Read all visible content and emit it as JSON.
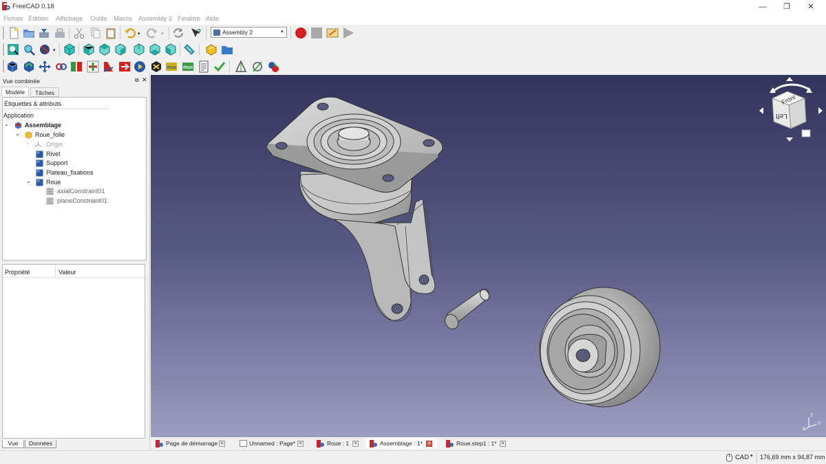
{
  "window": {
    "title": "FreeCAD 0.18",
    "minimize_glyph": "—",
    "restore_glyph": "❐",
    "close_glyph": "✕"
  },
  "menu": {
    "items": [
      "Fichier",
      "Édition",
      "Affichage",
      "Outils",
      "Macro",
      "Assembly 2",
      "Fenêtre",
      "Aide"
    ]
  },
  "toolbar": {
    "workbench_selector": "Assembly 2"
  },
  "combo_view": {
    "title": "Vue combinée",
    "tabs": [
      "Modèle",
      "Tâches"
    ],
    "labels_header": "Étiquettes & attributs",
    "tree": {
      "application": "Application",
      "root": "Assemblage",
      "part": "Roue_folle",
      "origin": "Origin",
      "rivet": "Rivet",
      "support": "Support",
      "plateau": "Plateau_fixations",
      "roue": "Roue",
      "axial": "axialConstraint01",
      "plane": "planeConstraint01"
    },
    "property_header": "Propriété",
    "value_header": "Valeur",
    "bottom_tabs": [
      "Vue",
      "Données"
    ]
  },
  "navcube": {
    "top_face": "Front",
    "front_face": "Left"
  },
  "doc_tabs": [
    {
      "label": "Page de démarrage"
    },
    {
      "label": "Unnamed : Page*"
    },
    {
      "label": "Roue : 1"
    },
    {
      "label": "Assemblage : 1*"
    },
    {
      "label": "Roue.step1 : 1*"
    }
  ],
  "status": {
    "nav_style": "CAD",
    "dimensions": "176,69 mm x 94,87 mm"
  },
  "axis_labels": {
    "x": "X",
    "y": "Y",
    "z": "Z"
  },
  "colors": {
    "accent_record": "#d62020",
    "viewport_top": "#33335c",
    "viewport_bottom": "#9d9dc1",
    "part_gray": "#bdbdbd"
  }
}
